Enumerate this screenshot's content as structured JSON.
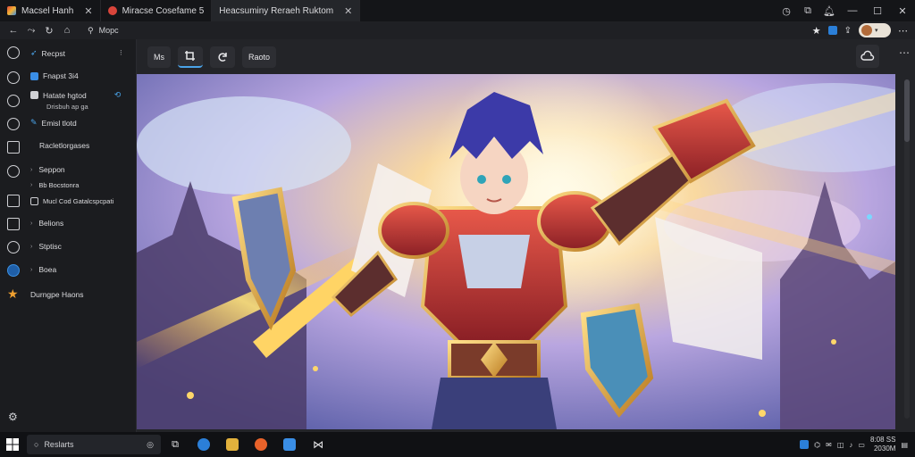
{
  "colors": {
    "accent": "#4aa3e8",
    "star": "#f0a030",
    "tab_fav_red": "#d9453b",
    "app_blue": "#2b7fd8",
    "app_yellow": "#e2b13c",
    "app_orange": "#e8622a"
  },
  "tabs": [
    {
      "label": "Macsel Hanh",
      "active": false
    },
    {
      "label": "Miracse Cosefame 5",
      "active": false
    },
    {
      "label": "Heacsuminy Reraeh Ruktom",
      "active": true
    }
  ],
  "window_controls": {
    "minimize": "—",
    "maximize": "☐",
    "close": "✕"
  },
  "address": {
    "url": "Mopc"
  },
  "sidebar": {
    "items": [
      {
        "label": "Recpst",
        "icon": "bookmark-icon"
      },
      {
        "label": "Fnapst 3i4",
        "icon": "image-icon"
      },
      {
        "label": "Hatate hgtod",
        "sub": "Drisbuh ap ga",
        "icon": "file-icon"
      },
      {
        "label": "Emisl tlotd",
        "icon": "brush-icon"
      },
      {
        "label": "Racletlorgases",
        "icon": "folder-icon"
      },
      {
        "label": "Seppon",
        "icon": "tag-icon"
      },
      {
        "label": "Bb Bocstonra",
        "icon": "layers-icon"
      },
      {
        "label": "Mucl Cod Gatalcspcpati",
        "icon": "grid-icon"
      },
      {
        "label": "Belions",
        "icon": "list-icon"
      },
      {
        "label": "Stptisc",
        "icon": "chat-icon"
      },
      {
        "label": "Boea",
        "icon": "globe-icon"
      },
      {
        "label": "Durngpe Haons",
        "icon": "star-icon"
      }
    ]
  },
  "toolbar": {
    "btn1": "Ms",
    "btn4": "Raoto"
  },
  "taskbar": {
    "search_placeholder": "Reslarts",
    "clock_time": "8:08 SS",
    "clock_date": "2030M"
  }
}
